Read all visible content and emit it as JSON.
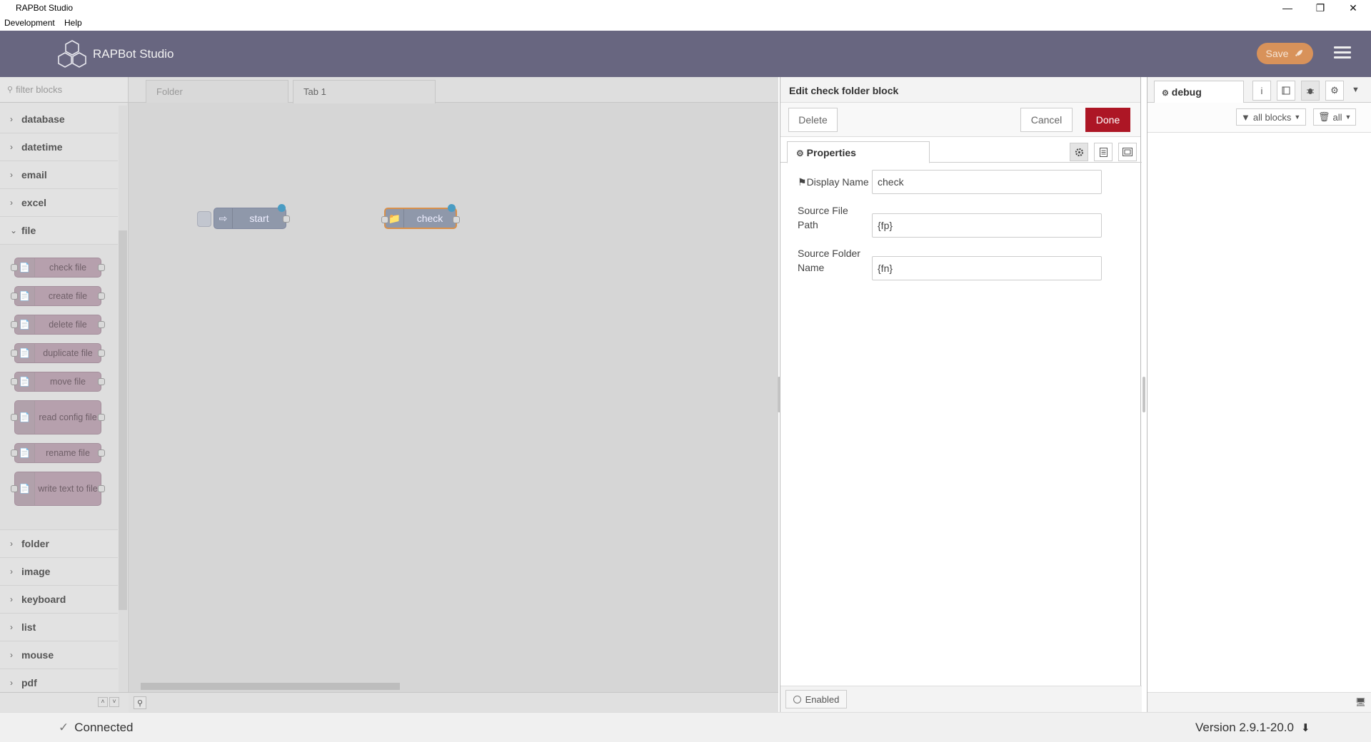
{
  "window": {
    "title": "RAPBot Studio",
    "controls": [
      "minimize",
      "restore",
      "close"
    ]
  },
  "menubar": {
    "items": [
      "Development",
      "Help"
    ]
  },
  "header": {
    "app_name": "RAPBot Studio",
    "save_label": "Save",
    "save_color": "#d8925a",
    "header_color": "#686680"
  },
  "palette": {
    "filter_placeholder": "filter blocks",
    "categories_top": [
      "database",
      "datetime",
      "email",
      "excel"
    ],
    "expanded_category": "file",
    "file_nodes": [
      "check file",
      "create file",
      "delete file",
      "duplicate file",
      "move file",
      "read config file",
      "rename file",
      "write text to file"
    ],
    "categories_bottom": [
      "folder",
      "image",
      "keyboard",
      "list",
      "mouse",
      "pdf"
    ]
  },
  "workspace": {
    "tabs": [
      "Folder",
      "Tab 1"
    ],
    "active_tab": "Tab 1",
    "nodes": [
      "start",
      "check"
    ]
  },
  "tray": {
    "title": "Edit check folder block",
    "delete_label": "Delete",
    "cancel_label": "Cancel",
    "done_label": "Done",
    "properties_tab": "Properties",
    "fields": [
      {
        "label": "Display Name",
        "value": "check"
      },
      {
        "label": "Source File Path",
        "value": "{fp}"
      },
      {
        "label": "Source Folder Name",
        "value": "{fn}"
      }
    ],
    "enabled_label": "Enabled"
  },
  "sidebar": {
    "tab_label": "debug",
    "filter_label": "all blocks",
    "clear_label": "all"
  },
  "status": {
    "connection": "Connected",
    "version": "Version 2.9.1-20.0"
  }
}
